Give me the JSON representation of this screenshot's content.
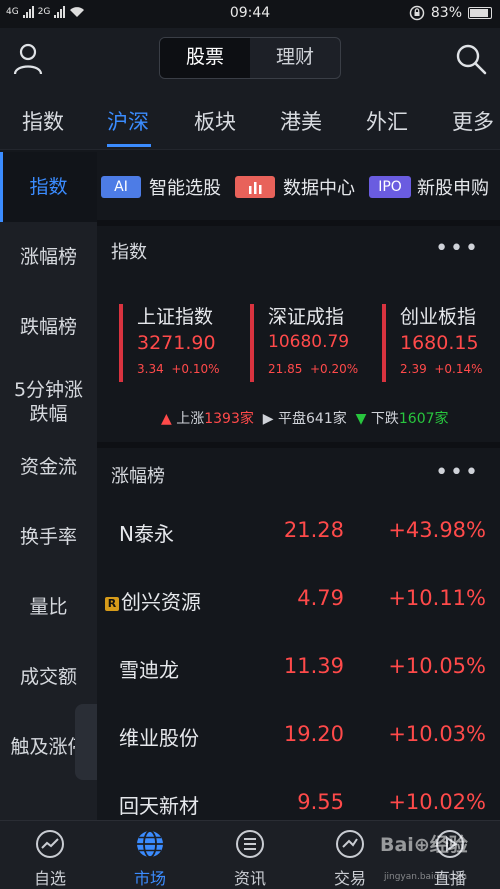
{
  "status_bar": {
    "signal1": "4G",
    "signal2": "2G",
    "time": "09:44",
    "battery": "83%"
  },
  "header": {
    "segment": [
      "股票",
      "理财"
    ],
    "active_segment": "股票"
  },
  "market_tabs": [
    "指数",
    "沪深",
    "板块",
    "港美",
    "外汇",
    "更多"
  ],
  "active_market_tab": "沪深",
  "sidebar": {
    "items": [
      {
        "label": "指数"
      },
      {
        "label": "涨幅榜"
      },
      {
        "label": "跌幅榜"
      },
      {
        "label": "5分钟涨\n跌幅"
      },
      {
        "label": "资金流"
      },
      {
        "label": "换手率"
      },
      {
        "label": "量比"
      },
      {
        "label": "成交额"
      },
      {
        "label": "触及涨停"
      }
    ],
    "active": "指数"
  },
  "quick_links": [
    {
      "badge": "AI",
      "label": "智能选股",
      "color": "#4d7ce6"
    },
    {
      "badge": "chart-icon",
      "label": "数据中心",
      "color": "#e8625a"
    },
    {
      "badge": "IPO",
      "label": "新股申购",
      "color": "#6a5ce0"
    }
  ],
  "index_panel": {
    "title": "指数",
    "more": "•••",
    "indices": [
      {
        "name": "上证指数",
        "value": "3271.90",
        "change": "3.34",
        "pct": "+0.10%"
      },
      {
        "name": "深证成指",
        "value": "10680.79",
        "change": "21.85",
        "pct": "+0.20%"
      },
      {
        "name": "创业板指",
        "value": "1680.15",
        "change": "2.39",
        "pct": "+0.14%"
      }
    ],
    "breadth": {
      "up_label": "上涨",
      "up_count": "1393家",
      "flat_label": "平盘",
      "flat_count": "641家",
      "down_label": "下跌",
      "down_count": "1607家"
    }
  },
  "rank_panel": {
    "title": "涨幅榜",
    "more": "•••",
    "rows": [
      {
        "name": "N泰永",
        "price": "21.28",
        "pct": "+43.98%",
        "badge": ""
      },
      {
        "name": "创兴资源",
        "price": "4.79",
        "pct": "+10.11%",
        "badge": "R"
      },
      {
        "name": "雪迪龙",
        "price": "11.39",
        "pct": "+10.05%",
        "badge": ""
      },
      {
        "name": "维业股份",
        "price": "19.20",
        "pct": "+10.03%",
        "badge": ""
      },
      {
        "name": "回天新材",
        "price": "9.55",
        "pct": "+10.02%",
        "badge": ""
      }
    ]
  },
  "bottom_nav": [
    {
      "label": "自选",
      "icon": "watchlist-icon"
    },
    {
      "label": "市场",
      "icon": "globe-icon"
    },
    {
      "label": "资讯",
      "icon": "news-icon"
    },
    {
      "label": "交易",
      "icon": "trade-icon"
    },
    {
      "label": "直播",
      "icon": "live-icon"
    }
  ],
  "active_bottom_nav": "市场",
  "watermark": {
    "text": "Bai⊕经验",
    "sub": "jingyan.baidu.com"
  }
}
